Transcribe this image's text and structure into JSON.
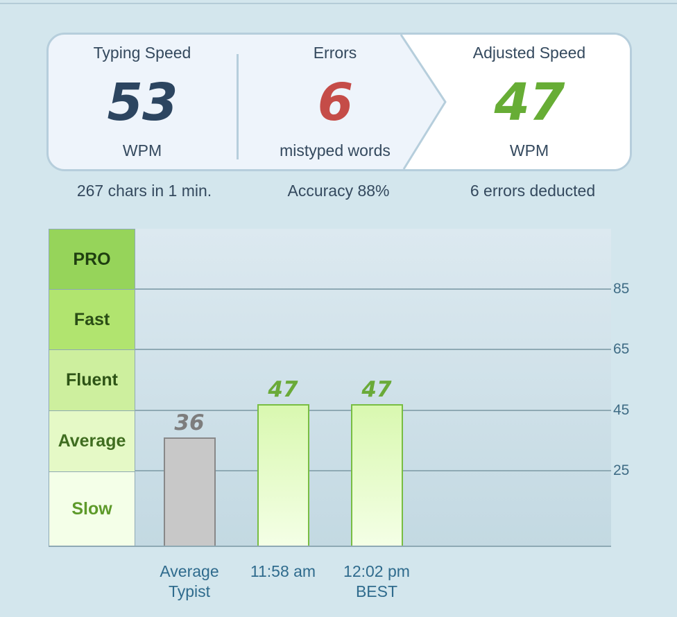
{
  "card": {
    "typing_speed": {
      "label": "Typing Speed",
      "value": "53",
      "unit": "WPM"
    },
    "errors": {
      "label": "Errors",
      "value": "6",
      "unit": "mistyped words"
    },
    "adjusted_speed": {
      "label": "Adjusted Speed",
      "value": "47",
      "unit": "WPM"
    }
  },
  "subtexts": {
    "chars": "267 chars in 1 min.",
    "accuracy": "Accuracy 88%",
    "deducted": "6 errors deducted"
  },
  "levels": [
    "PRO",
    "Fast",
    "Fluent",
    "Average",
    "Slow"
  ],
  "colors": {
    "speed": "#2c4560",
    "errors": "#c54c48",
    "adjusted": "#67ad35",
    "gray_bar": "#c8c8c8",
    "green_bar_border": "#78bd42"
  },
  "chart_data": {
    "type": "bar",
    "categories": [
      "Average Typist",
      "11:58 am",
      "12:02 pm BEST"
    ],
    "category_lines": [
      [
        "Average",
        "Typist"
      ],
      [
        "11:58 am"
      ],
      [
        "12:02 pm",
        "BEST"
      ]
    ],
    "values": [
      36,
      47,
      47
    ],
    "value_labels": [
      "36",
      "47",
      "47"
    ],
    "yticks": [
      25,
      45,
      65,
      85
    ],
    "ytick_labels": [
      "25",
      "45",
      "65",
      "85"
    ],
    "grid": true
  }
}
